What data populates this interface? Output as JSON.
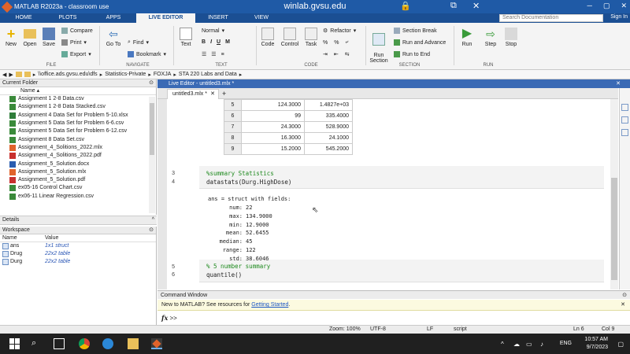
{
  "remote": {
    "title": "winlab.gvsu.edu"
  },
  "window": {
    "title": "MATLAB R2023a - classroom use"
  },
  "tabs": [
    {
      "label": "HOME"
    },
    {
      "label": "PLOTS"
    },
    {
      "label": "APPS"
    },
    {
      "label": "LIVE EDITOR"
    },
    {
      "label": "INSERT"
    },
    {
      "label": "VIEW"
    }
  ],
  "search": {
    "placeholder": "Search Documentation"
  },
  "signin": "Sign In",
  "ribbon": {
    "new": "New",
    "open": "Open",
    "save": "Save",
    "compare": "Compare",
    "print": "Print",
    "export": "Export",
    "goto": "Go To",
    "find": "Find",
    "bookmark": "Bookmark",
    "text": "Text",
    "normal": "Normal",
    "code": "Code",
    "control": "Control",
    "task": "Task",
    "refactor": "Refactor",
    "run_section": "Run\nSection",
    "section_break": "Section Break",
    "run_advance": "Run and Advance",
    "run_end": "Run to End",
    "run": "Run",
    "step": "Step",
    "stop": "Stop",
    "groups": {
      "file": "FILE",
      "navigate": "NAVIGATE",
      "text": "TEXT",
      "code": "CODE",
      "section": "SECTION",
      "run": "RUN"
    }
  },
  "path": [
    "\\\\office.ads.gvsu.edu\\dfs",
    "Statistics-Private",
    "FOXJA",
    "STA 220 Labs and Data"
  ],
  "current_folder": {
    "title": "Current Folder",
    "col_name": "Name",
    "files": [
      {
        "name": "Assignment 1 2-8 Data.csv",
        "icon": "csv-icon"
      },
      {
        "name": "Assignment 1 2-8 Data Stacked.csv",
        "icon": "csv-icon"
      },
      {
        "name": "Assignment 4 Data Set for Problem 5-10.xlsx",
        "icon": "xlsx-icon"
      },
      {
        "name": "Assignment 5 Data Set for Problem 6-6.csv",
        "icon": "csv-icon"
      },
      {
        "name": "Assignment 5 Data Set for Problem 6-12.csv",
        "icon": "csv-icon"
      },
      {
        "name": "Assignment 8 Data Set.csv",
        "icon": "csv-icon"
      },
      {
        "name": "Assignment_4_Solitions_2022.mlx",
        "icon": "mlx-icon"
      },
      {
        "name": "Assignment_4_Solitions_2022.pdf",
        "icon": "pdf-icon"
      },
      {
        "name": "Assignment_5_Solution.docx",
        "icon": "docx-icon"
      },
      {
        "name": "Assignment_5_Solution.mlx",
        "icon": "mlx-icon"
      },
      {
        "name": "Assignment_5_Solution.pdf",
        "icon": "pdf-icon"
      },
      {
        "name": "ex05-16 Control Chart.csv",
        "icon": "csv-icon"
      },
      {
        "name": "ex06-11 Linear Regression.csv",
        "icon": "csv-icon"
      }
    ]
  },
  "details": "Details",
  "workspace": {
    "title": "Workspace",
    "col_name": "Name",
    "col_value": "Value",
    "vars": [
      {
        "name": "ans",
        "value": "1x1 struct"
      },
      {
        "name": "Drug",
        "value": "22x2 table"
      },
      {
        "name": "Durg",
        "value": "22x2 table"
      }
    ]
  },
  "editor": {
    "header": "Live Editor - untitled3.mlx *",
    "tab": "untitled3.mlx *",
    "table_rows": [
      {
        "idx": "5",
        "c1": "124.3000",
        "c2": "1.4827e+03"
      },
      {
        "idx": "6",
        "c1": "99",
        "c2": "335.4000"
      },
      {
        "idx": "7",
        "c1": "24.3000",
        "c2": "528.9000"
      },
      {
        "idx": "8",
        "c1": "16.3000",
        "c2": "24.1000"
      },
      {
        "idx": "9",
        "c1": "15.2000",
        "c2": "545.2000"
      }
    ],
    "lines": [
      {
        "num": "3",
        "text": "%summary Statistics",
        "comment": true
      },
      {
        "num": "4",
        "text": "datastats(Durg.HighDose)",
        "comment": false
      },
      {
        "num": "5",
        "text": "% 5 number summary",
        "comment": true
      },
      {
        "num": "6",
        "text": "quantile()",
        "comment": false
      }
    ],
    "output_header": "ans = struct with fields:",
    "output_fields": [
      {
        "key": "num:",
        "val": "22"
      },
      {
        "key": "max:",
        "val": "134.9000"
      },
      {
        "key": "min:",
        "val": "12.9000"
      },
      {
        "key": "mean:",
        "val": "52.6455"
      },
      {
        "key": "median:",
        "val": "45"
      },
      {
        "key": "range:",
        "val": "122"
      },
      {
        "key": "std:",
        "val": "38.6046"
      }
    ]
  },
  "command_window": {
    "title": "Command Window",
    "new_prefix": "New to MATLAB? See resources for ",
    "new_link": "Getting Started",
    "new_suffix": ".",
    "prompt": ">>"
  },
  "status": {
    "zoom": "Zoom: 100%",
    "encoding": "UTF-8",
    "eol": "LF",
    "mode": "script",
    "ln": "Ln 6",
    "col": "Col 9"
  },
  "taskbar": {
    "lang": "ENG",
    "time": "10:57 AM",
    "date": "9/7/2023"
  }
}
